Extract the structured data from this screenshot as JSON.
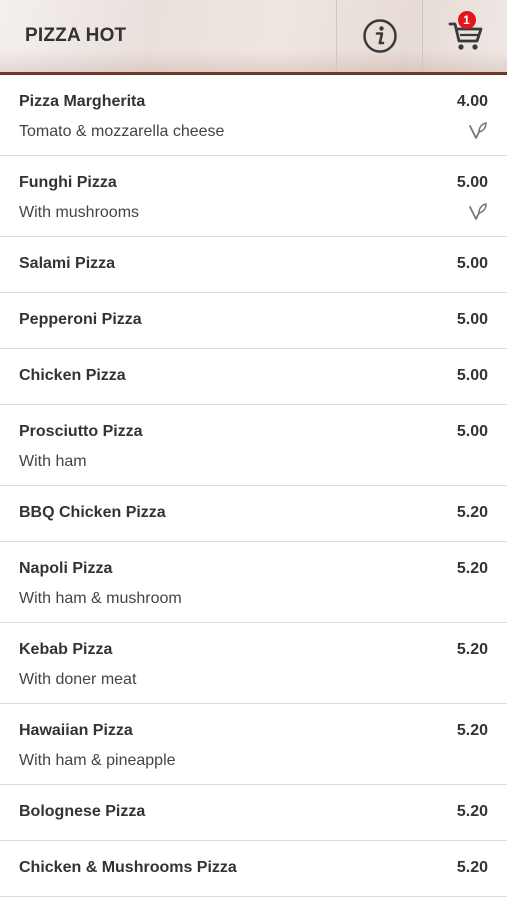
{
  "header": {
    "title": "PIZZA HOT",
    "info_icon": "info-icon",
    "cart_icon": "cart-icon",
    "cart_count": "1"
  },
  "menu": {
    "items": [
      {
        "name": "Pizza Margherita",
        "price": "4.00",
        "description": "Tomato & mozzarella cheese",
        "vegetarian": true
      },
      {
        "name": "Funghi Pizza",
        "price": "5.00",
        "description": "With mushrooms",
        "vegetarian": true
      },
      {
        "name": "Salami Pizza",
        "price": "5.00",
        "description": "",
        "vegetarian": false
      },
      {
        "name": "Pepperoni Pizza",
        "price": "5.00",
        "description": "",
        "vegetarian": false
      },
      {
        "name": "Chicken Pizza",
        "price": "5.00",
        "description": "",
        "vegetarian": false
      },
      {
        "name": "Prosciutto Pizza",
        "price": "5.00",
        "description": "With ham",
        "vegetarian": false
      },
      {
        "name": "BBQ Chicken Pizza",
        "price": "5.20",
        "description": "",
        "vegetarian": false
      },
      {
        "name": "Napoli Pizza",
        "price": "5.20",
        "description": "With ham & mushroom",
        "vegetarian": false
      },
      {
        "name": "Kebab Pizza",
        "price": "5.20",
        "description": "With doner meat",
        "vegetarian": false
      },
      {
        "name": "Hawaiian Pizza",
        "price": "5.20",
        "description": "With ham & pineapple",
        "vegetarian": false
      },
      {
        "name": "Bolognese Pizza",
        "price": "5.20",
        "description": "",
        "vegetarian": false
      },
      {
        "name": "Chicken & Mushrooms Pizza",
        "price": "5.20",
        "description": "",
        "vegetarian": false
      }
    ]
  },
  "colors": {
    "badge": "#e3161b",
    "header_border": "#6b3b2c",
    "text": "#333333"
  }
}
